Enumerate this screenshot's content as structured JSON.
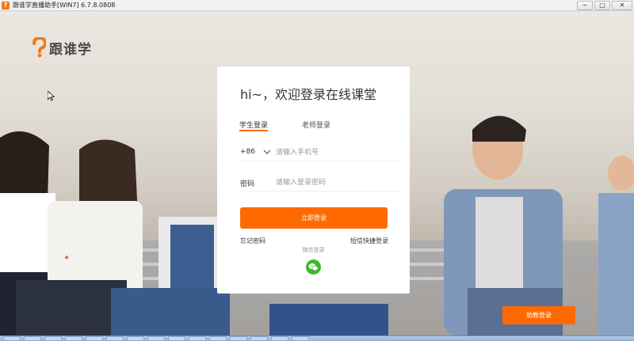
{
  "window": {
    "title": "跟谁学直播助手[WIN7] 6.7.8.0808",
    "controls": [
      "─",
      "□",
      "✕"
    ]
  },
  "logo": {
    "text": "跟谁学",
    "icon": "question-mark-logo-icon",
    "brand_color": "#f07a1a"
  },
  "login": {
    "title": "hi~，欢迎登录在线课堂",
    "tabs": [
      {
        "label": "学生登录",
        "active": true
      },
      {
        "label": "老师登录",
        "active": false
      }
    ],
    "phone": {
      "country_code": "+86",
      "placeholder": "请输入手机号",
      "value": ""
    },
    "password": {
      "label": "密码",
      "placeholder": "请输入登录密码",
      "value": ""
    },
    "submit_label": "立即登录",
    "forgot_label": "忘记密码",
    "sms_login_label": "短信快捷登录",
    "wechat_label": "微信登录",
    "wechat_icon": "wechat-icon"
  },
  "assistant_login_label": "助教登录",
  "colors": {
    "accent": "#ff6a00",
    "wechat": "#3fb62e"
  }
}
